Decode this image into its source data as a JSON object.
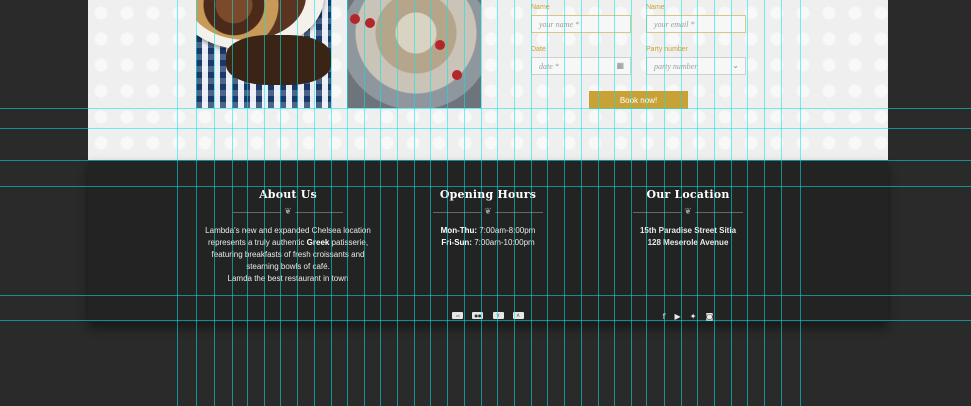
{
  "reservation": {
    "name_label": "Name",
    "name_placeholder": "your name *",
    "email_label": "Name",
    "email_placeholder": "your email *",
    "date_label": "Date",
    "date_placeholder": "date *",
    "party_label": "Party number",
    "party_placeholder": "party number",
    "book_button": "Book now!",
    "calendar_icon": "calendar-icon",
    "dropdown_icon": "chevron-down-icon"
  },
  "footer": {
    "about": {
      "title": "About Us",
      "line1": "Lambda's new and expanded Chelsea location",
      "line2_pre": "represents a truly authentic ",
      "line2_bold": "Greek",
      "line2_post": " patisserie,",
      "line3": "featuring breakfasts of fresh croissants and",
      "line4": "steaming bowls of café.",
      "line5": "Lamda the best restaurant in town"
    },
    "hours": {
      "title": "Opening Hours",
      "row1_label": "Mon-Thu:",
      "row1_value": " 7:00am-8:00pm",
      "row2_label": "Fri-Sun:",
      "row2_value": " 7:00am-10:00pm",
      "payment_icons": [
        "card-icon",
        "mastercard-icon",
        "visa-icon",
        "amex-icon"
      ]
    },
    "location": {
      "title": "Our Location",
      "address1": "15th Paradise Street Sitia",
      "address2": "128 Meserole Avenue",
      "social_icons": [
        "facebook-icon",
        "youtube-icon",
        "twitter-icon",
        "instagram-icon"
      ]
    }
  },
  "colors": {
    "accent": "#c8a137",
    "footer_bg": "#232323",
    "page_bg": "#2a2a2a",
    "guide": "#00eaea"
  }
}
